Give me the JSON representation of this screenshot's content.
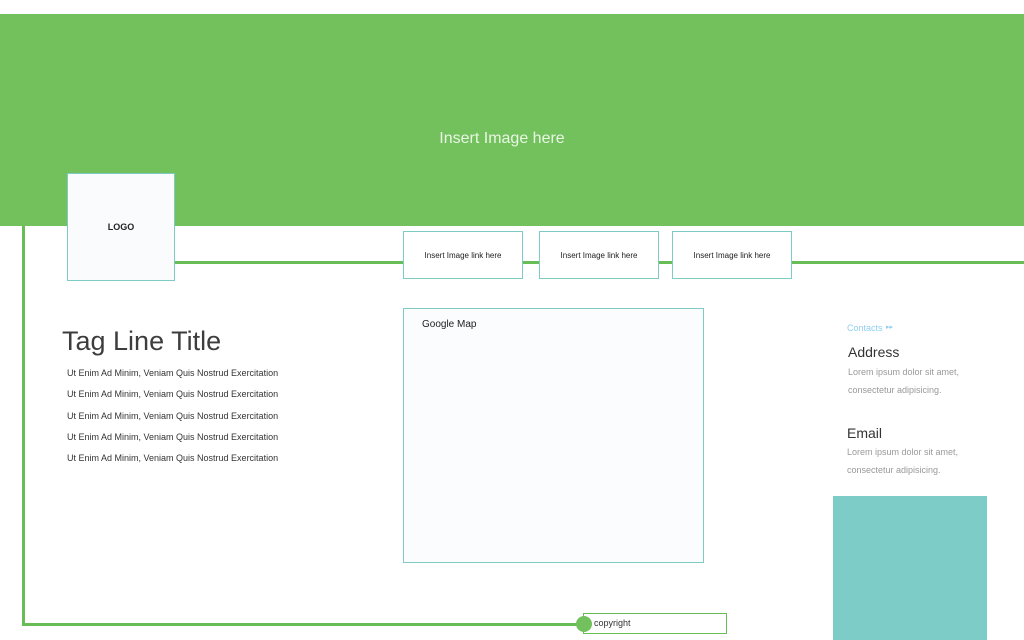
{
  "hero": {
    "placeholder": "Insert Image here",
    "color": "#72c15d"
  },
  "logo": {
    "label": "LOGO"
  },
  "nav_links": [
    {
      "label": "Insert Image link here"
    },
    {
      "label": "Insert Image link here"
    },
    {
      "label": "Insert Image link here"
    }
  ],
  "tagline": {
    "title": "Tag Line Title",
    "items": [
      "Ut Enim Ad Minim, Veniam Quis Nostrud Exercitation",
      "Ut Enim Ad Minim, Veniam Quis Nostrud Exercitation",
      "Ut Enim Ad Minim, Veniam Quis Nostrud Exercitation",
      "Ut Enim Ad Minim, Veniam Quis Nostrud Exercitation",
      "Ut Enim Ad Minim, Veniam Quis Nostrud Exercitation"
    ]
  },
  "map": {
    "label": "Google Map"
  },
  "contacts": {
    "section_label": "Contacts",
    "address": {
      "heading": "Address",
      "line1": "Lorem ipsum dolor sit amet,",
      "line2": "consectetur adipisicing."
    },
    "email": {
      "heading": "Email",
      "line1": "Lorem ipsum dolor sit amet,",
      "line2": "consectetur adipisicing."
    }
  },
  "footer": {
    "copyright": "copyright"
  },
  "colors": {
    "accent_green": "#72c15d",
    "frame_teal": "#7ecbc6",
    "contacts_blue": "#8fcff0"
  }
}
